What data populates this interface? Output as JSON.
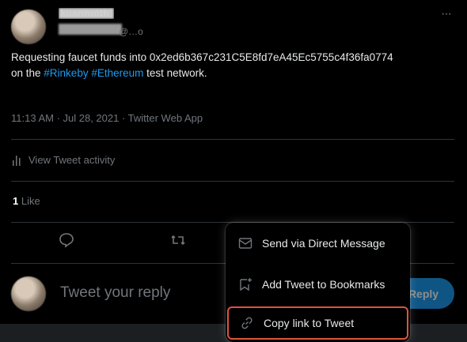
{
  "tweet": {
    "author_name": "kuanmoth",
    "author_handle": "@…o",
    "text_part1": "Requesting faucet funds into 0x2ed6b367c231C5E8fd7eA45Ec5755c4f36fa0774",
    "text_part2_prefix": "on the ",
    "hashtag1": "#Rinkeby",
    "hashtag2": "#Ethereum",
    "text_part2_suffix": " test network.",
    "timestamp": "11:13 AM · Jul 28, 2021 · Twitter Web App",
    "more_label": "···"
  },
  "activity": {
    "label": "View Tweet activity"
  },
  "stats": {
    "like_count": "1",
    "like_label": "Like"
  },
  "reply": {
    "placeholder": "Tweet your reply",
    "button_label": "Reply"
  },
  "share_menu": {
    "items": [
      {
        "label": "Send via Direct Message"
      },
      {
        "label": "Add Tweet to Bookmarks"
      },
      {
        "label": "Copy link to Tweet"
      }
    ],
    "highlight_color": "#e0533b"
  }
}
